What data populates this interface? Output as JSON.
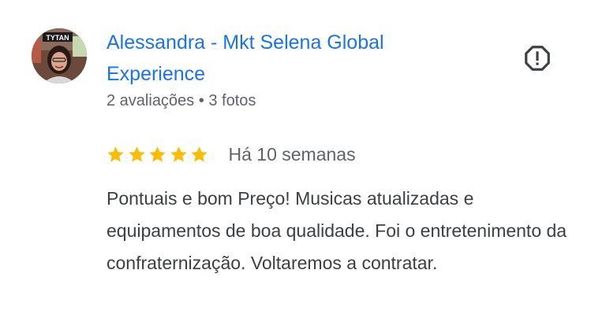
{
  "author": {
    "name": "Alessandra - Mkt Selena Global Experience",
    "reviews_count": "2 avaliações",
    "separator": "•",
    "photos_count": "3 fotos",
    "avatar_sign_text": "TYTAN"
  },
  "review": {
    "rating": 5,
    "rating_max": 5,
    "time_ago": "Há 10 semanas",
    "text": "Pontuais e bom Preço! Musicas atualizadas e equipamentos de boa qualidade. Foi o entretenimento da confraternização. Voltaremos a contratar."
  },
  "icons": {
    "report": "report-octagon-icon",
    "star": "star-icon"
  },
  "colors": {
    "author_link": "#1a73e8",
    "star_fill": "#fbbc04",
    "meta_text": "#5f6368",
    "body_text": "#3c4043",
    "report_icon": "#3c4043"
  }
}
